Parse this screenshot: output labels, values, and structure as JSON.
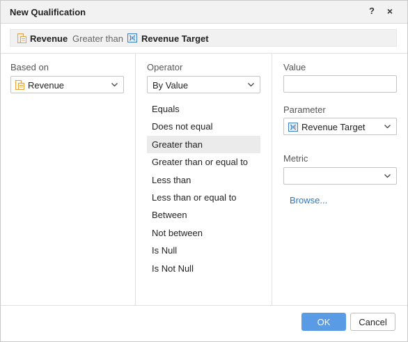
{
  "dialog": {
    "title": "New Qualification",
    "help_label": "?",
    "close_label": "×"
  },
  "summary": {
    "field": "Revenue",
    "operator": "Greater than",
    "target": "Revenue Target"
  },
  "based_on": {
    "label": "Based on",
    "value": "Revenue"
  },
  "operator": {
    "label": "Operator",
    "mode": "By Value",
    "items": [
      "Equals",
      "Does not equal",
      "Greater than",
      "Greater than or equal to",
      "Less than",
      "Less than or equal to",
      "Between",
      "Not between",
      "Is Null",
      "Is Not Null"
    ],
    "selected": "Greater than"
  },
  "value": {
    "label": "Value",
    "current": ""
  },
  "parameter": {
    "label": "Parameter",
    "value": "Revenue Target"
  },
  "metric": {
    "label": "Metric",
    "value": "",
    "browse_label": "Browse..."
  },
  "buttons": {
    "ok": "OK",
    "cancel": "Cancel"
  },
  "colors": {
    "accent": "#5a9be6",
    "link": "#2b78c2",
    "attribute_icon": "#e8a33c",
    "parameter_icon": "#3b7fc4"
  },
  "icons": {
    "attribute": "attribute-icon",
    "parameter": "parameter-icon",
    "chevron": "chevron-down-icon"
  }
}
